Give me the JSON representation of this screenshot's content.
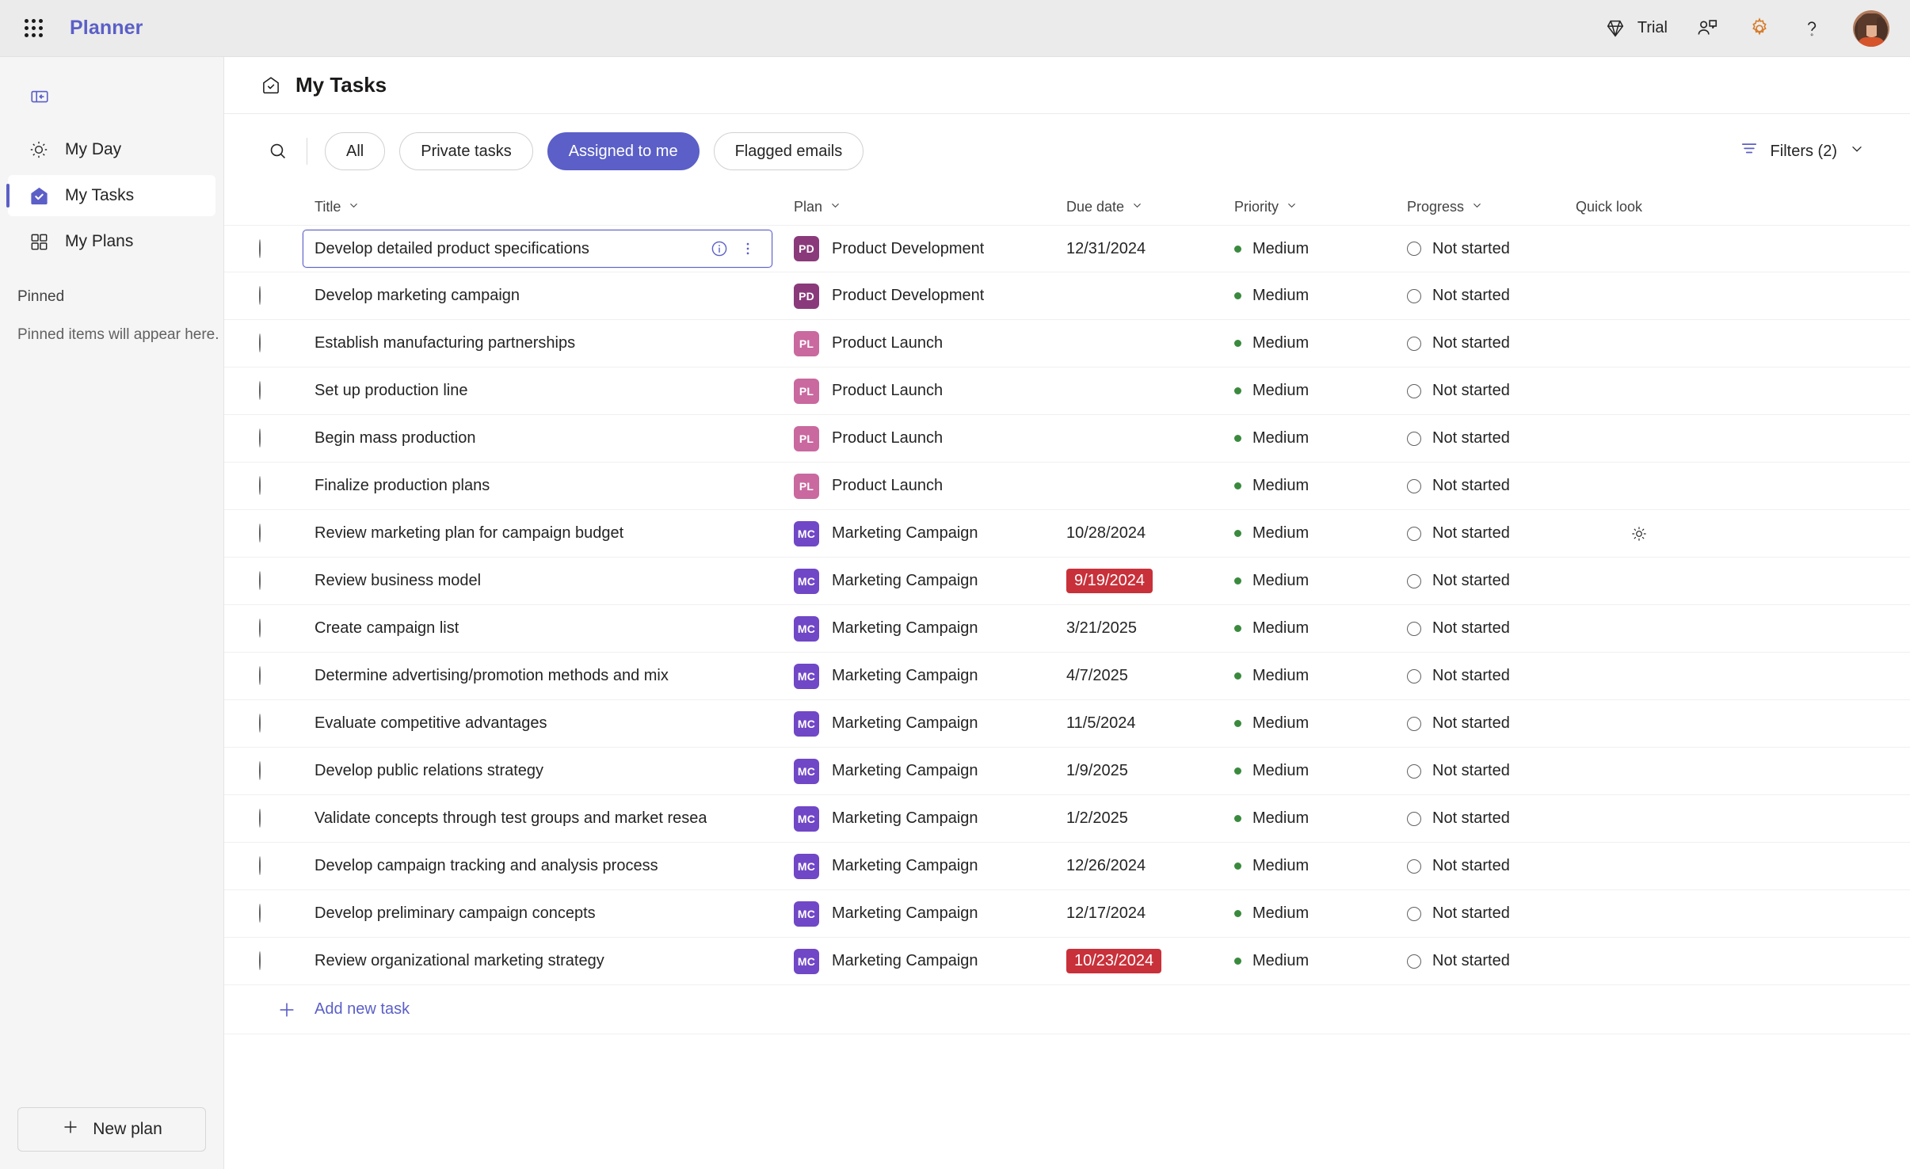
{
  "topbar": {
    "waffle_icon": "app-launcher-icon",
    "brand": "Planner",
    "trial_label": "Trial",
    "trial_icon": "diamond-icon",
    "feedback_icon": "feedback-person-icon",
    "settings_icon": "gear-icon",
    "help_icon": "question-mark-icon",
    "avatar_icon": "user-avatar",
    "settings_color": "#d67b29"
  },
  "sidebar": {
    "collapse_icon": "collapse-panel-icon",
    "items": [
      {
        "label": "My Day",
        "icon": "sun-icon",
        "active": false
      },
      {
        "label": "My Tasks",
        "icon": "tasks-home-check-icon",
        "active": true
      },
      {
        "label": "My Plans",
        "icon": "grid-squares-icon",
        "active": false
      }
    ],
    "pinned_heading": "Pinned",
    "pinned_empty": "Pinned items will appear here.",
    "new_plan_label": "New plan",
    "new_plan_icon": "plus-icon",
    "accent": "#5b5fc7"
  },
  "page": {
    "title": "My Tasks",
    "title_icon": "tasks-home-check-icon"
  },
  "toolbar": {
    "search_icon": "search-icon",
    "pills": [
      {
        "label": "All",
        "selected": false
      },
      {
        "label": "Private tasks",
        "selected": false
      },
      {
        "label": "Assigned to me",
        "selected": true
      },
      {
        "label": "Flagged emails",
        "selected": false
      }
    ],
    "filters_label": "Filters (2)",
    "filters_icon": "filter-icon",
    "filters_chevron": "chevron-down-icon"
  },
  "table": {
    "columns": [
      {
        "label": "Title",
        "sortable": true
      },
      {
        "label": "Plan",
        "sortable": true
      },
      {
        "label": "Due date",
        "sortable": true
      },
      {
        "label": "Priority",
        "sortable": true
      },
      {
        "label": "Progress",
        "sortable": true
      },
      {
        "label": "Quick look",
        "sortable": false
      }
    ],
    "plan_colors": {
      "PD": "#8a3a7a",
      "PL": "#c9699f",
      "MC": "#7047c6"
    },
    "overdue_color": "#c8313a",
    "priority_color": "#3a8a3e",
    "rows": [
      {
        "title": "Develop detailed product specifications",
        "plan_initials": "PD",
        "plan": "Product Development",
        "due": "12/31/2024",
        "overdue": false,
        "priority": "Medium",
        "progress": "Not started",
        "selected": true,
        "hovered": false,
        "info_icon": "info-circle-icon",
        "more_icon": "more-vertical-icon"
      },
      {
        "title": "Develop marketing campaign",
        "plan_initials": "PD",
        "plan": "Product Development",
        "due": "",
        "overdue": false,
        "priority": "Medium",
        "progress": "Not started",
        "selected": false,
        "hovered": false
      },
      {
        "title": "Establish manufacturing partnerships",
        "plan_initials": "PL",
        "plan": "Product Launch",
        "due": "",
        "overdue": false,
        "priority": "Medium",
        "progress": "Not started",
        "selected": false,
        "hovered": false
      },
      {
        "title": "Set up production line",
        "plan_initials": "PL",
        "plan": "Product Launch",
        "due": "",
        "overdue": false,
        "priority": "Medium",
        "progress": "Not started",
        "selected": false,
        "hovered": false
      },
      {
        "title": "Begin mass production",
        "plan_initials": "PL",
        "plan": "Product Launch",
        "due": "",
        "overdue": false,
        "priority": "Medium",
        "progress": "Not started",
        "selected": false,
        "hovered": false
      },
      {
        "title": "Finalize production plans",
        "plan_initials": "PL",
        "plan": "Product Launch",
        "due": "",
        "overdue": false,
        "priority": "Medium",
        "progress": "Not started",
        "selected": false,
        "hovered": false
      },
      {
        "title": "Review marketing plan for campaign budget",
        "plan_initials": "MC",
        "plan": "Marketing Campaign",
        "due": "10/28/2024",
        "overdue": false,
        "priority": "Medium",
        "progress": "Not started",
        "selected": false,
        "hovered": true,
        "quick_icon": "sun-icon"
      },
      {
        "title": "Review business model",
        "plan_initials": "MC",
        "plan": "Marketing Campaign",
        "due": "9/19/2024",
        "overdue": true,
        "priority": "Medium",
        "progress": "Not started",
        "selected": false,
        "hovered": false
      },
      {
        "title": "Create campaign list",
        "plan_initials": "MC",
        "plan": "Marketing Campaign",
        "due": "3/21/2025",
        "overdue": false,
        "priority": "Medium",
        "progress": "Not started",
        "selected": false,
        "hovered": false
      },
      {
        "title": "Determine advertising/promotion methods and mix",
        "plan_initials": "MC",
        "plan": "Marketing Campaign",
        "due": "4/7/2025",
        "overdue": false,
        "priority": "Medium",
        "progress": "Not started",
        "selected": false,
        "hovered": false
      },
      {
        "title": "Evaluate competitive advantages",
        "plan_initials": "MC",
        "plan": "Marketing Campaign",
        "due": "11/5/2024",
        "overdue": false,
        "priority": "Medium",
        "progress": "Not started",
        "selected": false,
        "hovered": false
      },
      {
        "title": "Develop public relations strategy",
        "plan_initials": "MC",
        "plan": "Marketing Campaign",
        "due": "1/9/2025",
        "overdue": false,
        "priority": "Medium",
        "progress": "Not started",
        "selected": false,
        "hovered": false
      },
      {
        "title": "Validate concepts through test groups and market resea",
        "plan_initials": "MC",
        "plan": "Marketing Campaign",
        "due": "1/2/2025",
        "overdue": false,
        "priority": "Medium",
        "progress": "Not started",
        "selected": false,
        "hovered": false
      },
      {
        "title": "Develop campaign tracking and analysis process",
        "plan_initials": "MC",
        "plan": "Marketing Campaign",
        "due": "12/26/2024",
        "overdue": false,
        "priority": "Medium",
        "progress": "Not started",
        "selected": false,
        "hovered": false
      },
      {
        "title": "Develop preliminary campaign concepts",
        "plan_initials": "MC",
        "plan": "Marketing Campaign",
        "due": "12/17/2024",
        "overdue": false,
        "priority": "Medium",
        "progress": "Not started",
        "selected": false,
        "hovered": false
      },
      {
        "title": "Review organizational marketing strategy",
        "plan_initials": "MC",
        "plan": "Marketing Campaign",
        "due": "10/23/2024",
        "overdue": true,
        "priority": "Medium",
        "progress": "Not started",
        "selected": false,
        "hovered": false
      }
    ],
    "add_task_label": "Add new task",
    "add_task_icon": "plus-icon"
  }
}
